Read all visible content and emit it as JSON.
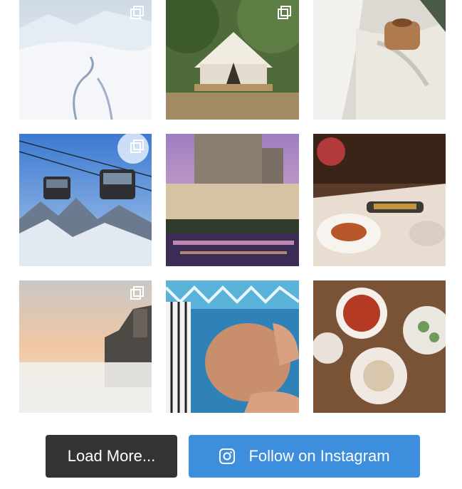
{
  "feed": {
    "photos": [
      {
        "icon": "snowy-mountain-photo",
        "multi": true
      },
      {
        "icon": "glamping-tent-photo",
        "multi": true
      },
      {
        "icon": "bathrobe-coffee-photo",
        "multi": false
      },
      {
        "icon": "cable-car-mountain-photo",
        "multi": true
      },
      {
        "icon": "hotel-night-photo",
        "multi": false
      },
      {
        "icon": "restaurant-dinner-photo",
        "multi": false
      },
      {
        "icon": "sunset-cliff-fog-photo",
        "multi": true
      },
      {
        "icon": "spa-face-massage-photo",
        "multi": false
      },
      {
        "icon": "food-table-overhead-photo",
        "multi": false
      }
    ]
  },
  "actions": {
    "load_more_label": "Load More...",
    "follow_label": "Follow on Instagram",
    "follow_icon": "instagram-icon"
  },
  "colors": {
    "load_more_bg": "#333333",
    "follow_bg": "#3e8ede",
    "button_text": "#ffffff"
  }
}
